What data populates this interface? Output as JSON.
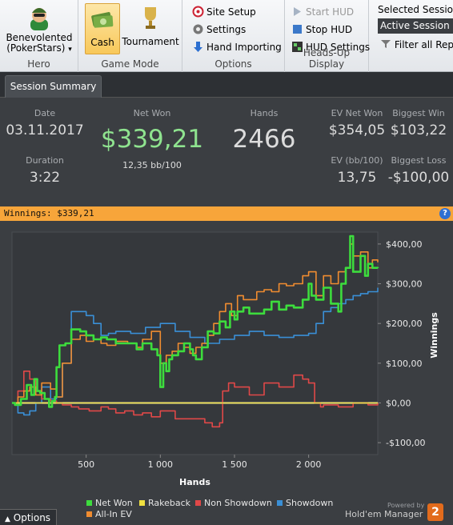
{
  "ribbon": {
    "hero": {
      "name": "Benevolented",
      "site": "(PokerStars)",
      "arrow": "▾",
      "group_label": "Hero"
    },
    "game_mode": {
      "cash": "Cash",
      "tournament": "Tournament",
      "group_label": "Game Mode"
    },
    "options": {
      "site_setup": "Site Setup",
      "settings": "Settings",
      "hand_importing": "Hand Importing",
      "group_label": "Options"
    },
    "hud": {
      "start": "Start HUD",
      "stop": "Stop HUD",
      "settings": "HUD Settings",
      "group_label": "Heads-Up Display"
    },
    "session": {
      "label": "Selected Session:",
      "value": "Active Session",
      "filter": "Filter all Repor"
    }
  },
  "tabs": {
    "summary": "Session Summary"
  },
  "stats": {
    "date": {
      "label": "Date",
      "value": "03.11.2017"
    },
    "duration": {
      "label": "Duration",
      "value": "3:22"
    },
    "net_won": {
      "label": "Net Won",
      "value": "$339,21",
      "sub": "12,35 bb/100"
    },
    "hands": {
      "label": "Hands",
      "value": "2466"
    },
    "ev_net_won": {
      "label": "EV Net Won",
      "value": "$354,05"
    },
    "ev_bb": {
      "label": "EV (bb/100)",
      "value": "13,75"
    },
    "biggest_win": {
      "label": "Biggest Win",
      "value": "$103,22"
    },
    "biggest_loss": {
      "label": "Biggest Loss",
      "value": "-$100,00"
    }
  },
  "winnings_bar": {
    "text": "Winnings: $339,21",
    "help": "?"
  },
  "legend": {
    "net_won": "Net Won",
    "rakeback": "Rakeback",
    "non_showdown": "Non Showdown",
    "showdown": "Showdown",
    "all_in_ev": "All-In EV"
  },
  "footer": {
    "options": "Options",
    "powered": "Powered by",
    "brand": "Hold'em Manager",
    "logo": "2"
  },
  "colors": {
    "net_won": "#3ddc3d",
    "rakeback": "#f0e040",
    "non_showdown": "#e04848",
    "showdown": "#3a8fd6",
    "all_in_ev": "#f08c30",
    "accent": "#f7a53a"
  },
  "chart_data": {
    "type": "line",
    "xlabel": "Hands",
    "ylabel": "Winnings",
    "xlim": [
      0,
      2466
    ],
    "ylim": [
      -130,
      430
    ],
    "xticks": [
      500,
      1000,
      1500,
      2000
    ],
    "xtick_labels": [
      "500",
      "1 000",
      "1 500",
      "2 000"
    ],
    "yticks": [
      -100,
      0,
      100,
      200,
      300,
      400
    ],
    "ytick_labels": [
      "-$100,00",
      "$0,00",
      "$100,00",
      "$200,00",
      "$300,00",
      "$400,00"
    ],
    "series": [
      {
        "name": "Net Won",
        "x": [
          0,
          20,
          60,
          100,
          130,
          150,
          170,
          190,
          220,
          250,
          270,
          290,
          300,
          320,
          360,
          400,
          460,
          500,
          550,
          600,
          640,
          700,
          780,
          840,
          880,
          900,
          940,
          980,
          1000,
          1020,
          1040,
          1060,
          1080,
          1120,
          1160,
          1200,
          1220,
          1240,
          1280,
          1320,
          1360,
          1400,
          1440,
          1470,
          1500,
          1520,
          1560,
          1600,
          1700,
          1750,
          1800,
          1850,
          1900,
          1960,
          2000,
          2020,
          2050,
          2100,
          2150,
          2200,
          2220,
          2250,
          2280,
          2300,
          2320,
          2350,
          2380,
          2400,
          2430,
          2466
        ],
        "y": [
          0,
          -5,
          10,
          45,
          20,
          60,
          30,
          25,
          10,
          -10,
          5,
          15,
          90,
          145,
          150,
          185,
          180,
          170,
          160,
          165,
          160,
          150,
          150,
          135,
          150,
          150,
          135,
          120,
          40,
          100,
          80,
          110,
          120,
          130,
          150,
          135,
          120,
          110,
          140,
          180,
          175,
          205,
          190,
          230,
          210,
          230,
          240,
          225,
          235,
          255,
          235,
          245,
          240,
          260,
          300,
          270,
          260,
          290,
          250,
          230,
          300,
          340,
          420,
          330,
          330,
          370,
          320,
          350,
          340,
          339.21
        ]
      },
      {
        "name": "Rakeback",
        "x": [
          0,
          2466
        ],
        "y": [
          0,
          0
        ]
      },
      {
        "name": "Non Showdown",
        "x": [
          0,
          40,
          80,
          120,
          160,
          200,
          260,
          300,
          340,
          400,
          450,
          520,
          600,
          650,
          700,
          760,
          820,
          880,
          940,
          1000,
          1100,
          1200,
          1300,
          1350,
          1400,
          1420,
          1460,
          1500,
          1600,
          1700,
          1800,
          1900,
          1960,
          2000,
          2040,
          2080,
          2100,
          2200,
          2300,
          2400,
          2466
        ],
        "y": [
          0,
          30,
          80,
          60,
          30,
          10,
          5,
          0,
          -5,
          -10,
          -15,
          -20,
          -10,
          -15,
          -25,
          -20,
          -30,
          -25,
          -35,
          -20,
          -40,
          -40,
          -50,
          -60,
          -50,
          30,
          50,
          40,
          20,
          50,
          40,
          70,
          60,
          50,
          0,
          -10,
          -5,
          -10,
          0,
          -5,
          0
        ]
      },
      {
        "name": "Showdown",
        "x": [
          0,
          40,
          80,
          120,
          160,
          200,
          260,
          300,
          340,
          400,
          500,
          550,
          600,
          650,
          700,
          800,
          900,
          1000,
          1100,
          1200,
          1300,
          1400,
          1500,
          1600,
          1700,
          1800,
          1900,
          2000,
          2050,
          2100,
          2150,
          2200,
          2250,
          2300,
          2350,
          2400,
          2466
        ],
        "y": [
          0,
          -25,
          -30,
          -20,
          0,
          40,
          10,
          15,
          100,
          230,
          220,
          200,
          170,
          175,
          180,
          175,
          190,
          200,
          180,
          165,
          150,
          160,
          170,
          180,
          170,
          165,
          170,
          175,
          200,
          230,
          240,
          250,
          260,
          270,
          275,
          280,
          290
        ]
      },
      {
        "name": "All-In EV",
        "x": [
          0,
          40,
          80,
          120,
          160,
          200,
          260,
          300,
          340,
          400,
          460,
          500,
          550,
          600,
          640,
          700,
          780,
          840,
          880,
          940,
          1000,
          1040,
          1080,
          1120,
          1160,
          1200,
          1240,
          1280,
          1320,
          1360,
          1400,
          1440,
          1480,
          1520,
          1560,
          1600,
          1650,
          1700,
          1750,
          1800,
          1850,
          1900,
          1960,
          2000,
          2050,
          2100,
          2150,
          2200,
          2250,
          2280,
          2300,
          2350,
          2400,
          2430,
          2466
        ],
        "y": [
          0,
          15,
          30,
          40,
          20,
          50,
          35,
          15,
          100,
          160,
          170,
          155,
          160,
          150,
          145,
          155,
          150,
          140,
          160,
          180,
          100,
          120,
          130,
          150,
          140,
          125,
          140,
          150,
          170,
          200,
          230,
          250,
          220,
          270,
          260,
          260,
          280,
          285,
          280,
          300,
          295,
          300,
          320,
          330,
          270,
          320,
          300,
          330,
          340,
          400,
          370,
          380,
          340,
          360,
          354.05
        ]
      }
    ]
  }
}
